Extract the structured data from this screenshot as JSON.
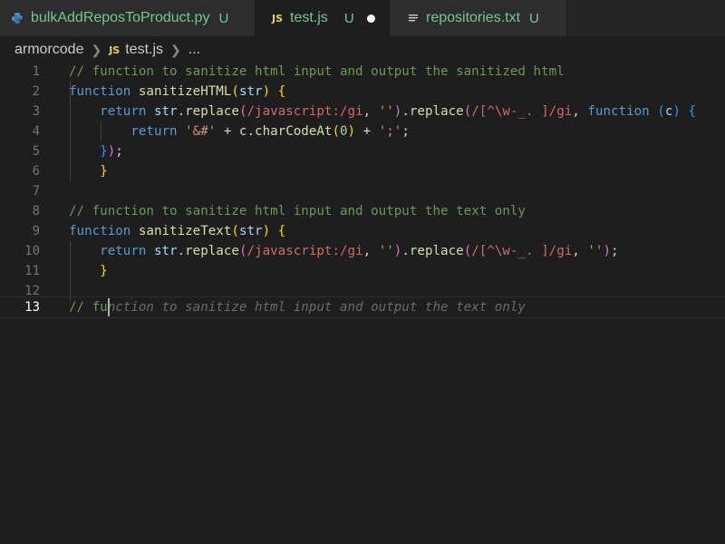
{
  "tabs": [
    {
      "name": "bulkAddReposToProduct.py",
      "status": "U",
      "icon": "python-icon",
      "active": false
    },
    {
      "name": "test.js",
      "status": "U",
      "icon": "js-icon",
      "active": true,
      "dirty": true
    },
    {
      "name": "repositories.txt",
      "status": "U",
      "icon": "text-file-icon",
      "active": false
    }
  ],
  "breadcrumb": {
    "folder": "armorcode",
    "file_badge": "JS",
    "file": "test.js",
    "ellipsis": "..."
  },
  "line_numbers": [
    "1",
    "2",
    "3",
    "4",
    "5",
    "6",
    "7",
    "8",
    "9",
    "10",
    "11",
    "12",
    "13"
  ],
  "active_line": "13",
  "code": {
    "l1": "// function to sanitize html input and output the sanitized html",
    "l2": {
      "kw": "function",
      "fn": "sanitizeHTML",
      "p1": "(",
      "param": "str",
      "p2": ")",
      "b": " {"
    },
    "l3": {
      "kw": "return",
      "a": " str.",
      "m1": "replace",
      "p1": "(",
      "re1": "/javascript:/gi",
      "c1": ", ",
      "s1": "''",
      "p2": ")",
      "dot": ".",
      "m2": "replace",
      "p3": "(",
      "re2": "/[^\\w-_. ]/gi",
      "c2": ", ",
      "kw2": "function",
      "sp": " ",
      "p4": "(",
      "param": "c",
      "p5": ")",
      "b": " {"
    },
    "l4": {
      "kw": "return",
      "s1": " '&#'",
      "op1": " + c.",
      "m": "charCodeAt",
      "p1": "(",
      "n": "0",
      "p2": ")",
      "op2": " + ",
      "s2": "';'",
      "semi": ";"
    },
    "l5": {
      "b": "}",
      "p": ")",
      "semi": ";"
    },
    "l6": "}",
    "l8": "// function to sanitize html input and output the text only",
    "l9": {
      "kw": "function",
      "fn": "sanitizeText",
      "p1": "(",
      "param": "str",
      "p2": ")",
      "b": " {"
    },
    "l10": {
      "kw": "return",
      "a": " str.",
      "m1": "replace",
      "p1": "(",
      "re1": "/javascript:/gi",
      "c1": ", ",
      "s1": "''",
      "p2": ")",
      "dot": ".",
      "m2": "replace",
      "p3": "(",
      "re2": "/[^\\w-_. ]/gi",
      "c2": ", ",
      "s2": "''",
      "p4": ")",
      "semi": ";"
    },
    "l11": "}",
    "l13_typed": "// fu",
    "l13_ghost": "nction to sanitize html input and output the text only"
  }
}
